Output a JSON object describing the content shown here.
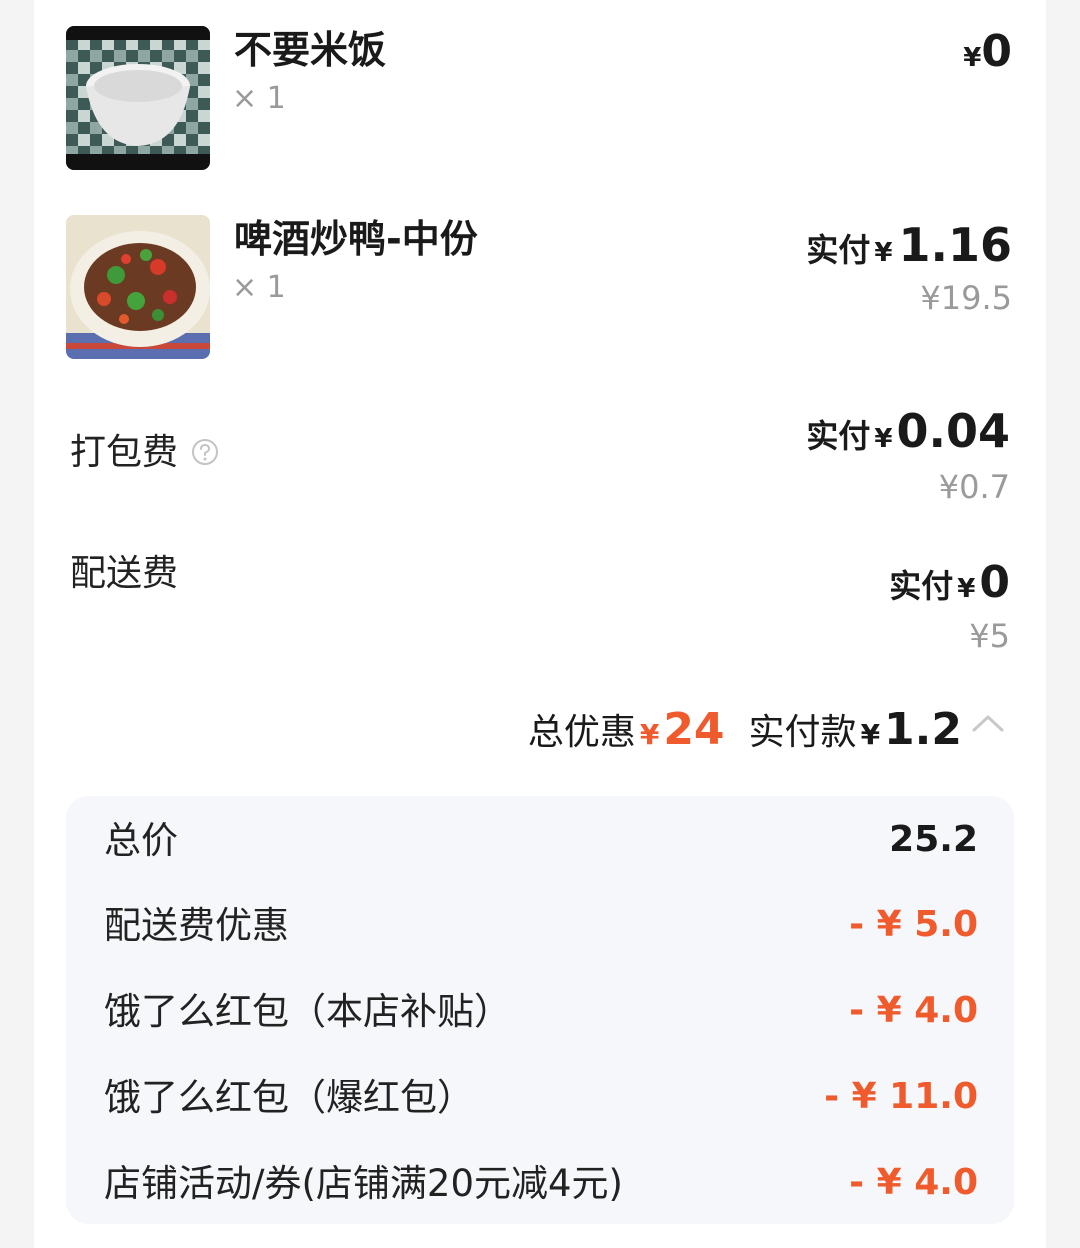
{
  "items": [
    {
      "name": "不要米饭",
      "qty": "× 1",
      "price_yen": "¥",
      "price": "0",
      "image": "empty-bowl-photo"
    },
    {
      "name": "啤酒炒鸭-中份",
      "qty": "× 1",
      "pay_label": "实付",
      "pay_yen": "¥",
      "pay_amount": "1.16",
      "original": "¥19.5",
      "image": "stir-fried-duck-photo"
    }
  ],
  "fees": {
    "packing": {
      "label": "打包费",
      "help_icon": "question-circle-icon",
      "pay_label": "实付",
      "pay_yen": "¥",
      "pay_amount": "0.04",
      "original": "¥0.7"
    },
    "delivery": {
      "label": "配送费",
      "pay_label": "实付",
      "pay_yen": "¥",
      "pay_amount": "0",
      "original": "¥5"
    }
  },
  "summary": {
    "discount_label": "总优惠",
    "discount_yen": "¥",
    "discount_amount": "24",
    "paid_label": "实付款",
    "paid_yen": "¥",
    "paid_amount": "1.2",
    "toggle_icon": "chevron-up-icon"
  },
  "breakdown": [
    {
      "label": "总价",
      "value": "25.2"
    },
    {
      "label": "配送费优惠",
      "value": "- ¥ 5.0"
    },
    {
      "label": "饿了么红包（本店补贴）",
      "value": "- ¥ 4.0"
    },
    {
      "label": "饿了么红包（爆红包）",
      "value": "- ¥ 11.0"
    },
    {
      "label": "店铺活动/券(店铺满20元减4元)",
      "value": "- ¥ 4.0"
    }
  ],
  "colors": {
    "accent": "#f05b2e",
    "muted": "#9a9a9a",
    "panel": "#f5f7fa"
  }
}
